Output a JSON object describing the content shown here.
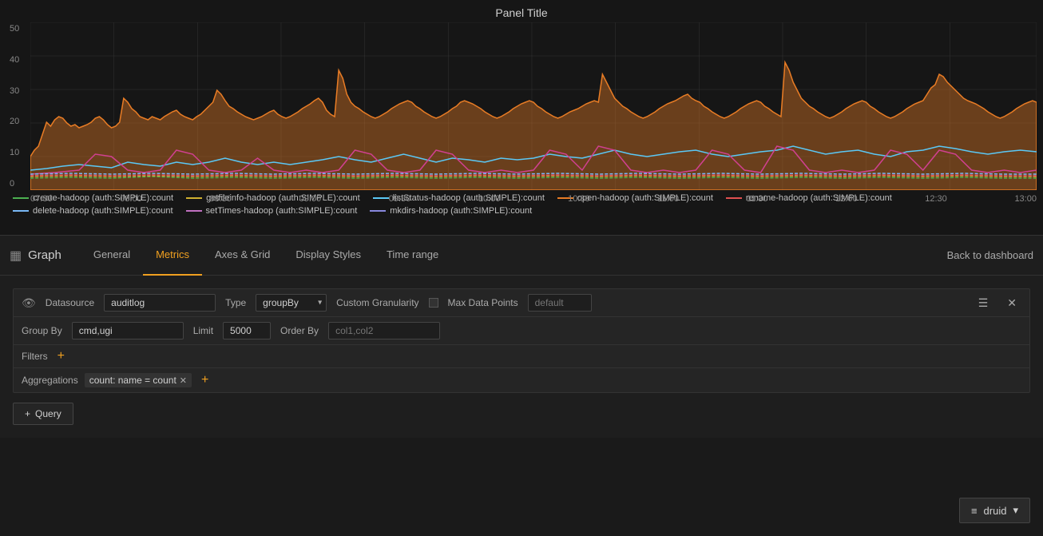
{
  "panel": {
    "title": "Panel Title",
    "yAxisLabels": [
      "0",
      "10",
      "20",
      "30",
      "40",
      "50"
    ],
    "xAxisLabels": [
      "07:30",
      "08:00",
      "08:30",
      "09:00",
      "09:30",
      "10:00",
      "10:30",
      "11:00",
      "11:30",
      "12:00",
      "12:30",
      "13:00"
    ],
    "legend": [
      {
        "label": "create-hadoop (auth:SIMPLE):count",
        "color": "#4caf50",
        "dashed": true
      },
      {
        "label": "getfileinfo-hadoop (auth:SIMPLE):count",
        "color": "#e0c040",
        "dashed": true
      },
      {
        "label": "listStatus-hadoop (auth:SIMPLE):count",
        "color": "#5bc8f5",
        "dashed": true
      },
      {
        "label": "open-hadoop (auth:SIMPLE):count",
        "color": "#e87c25",
        "dashed": false
      },
      {
        "label": "rename-hadoop (auth:SIMPLE):count",
        "color": "#e05050",
        "dashed": true
      },
      {
        "label": "delete-hadoop (auth:SIMPLE):count",
        "color": "#7ab8f5",
        "dashed": true
      },
      {
        "label": "setTimes-hadoop (auth:SIMPLE):count",
        "color": "#c070c0",
        "dashed": true
      },
      {
        "label": "mkdirs-hadoop (auth:SIMPLE):count",
        "color": "#8888dd",
        "dashed": true
      }
    ]
  },
  "tabs": {
    "graph_icon": "▦",
    "graph_label": "Graph",
    "items": [
      {
        "id": "general",
        "label": "General",
        "active": false
      },
      {
        "id": "metrics",
        "label": "Metrics",
        "active": true
      },
      {
        "id": "axes",
        "label": "Axes & Grid",
        "active": false
      },
      {
        "id": "display",
        "label": "Display Styles",
        "active": false
      },
      {
        "id": "timerange",
        "label": "Time range",
        "active": false
      }
    ],
    "back_button": "Back to dashboard"
  },
  "query": {
    "datasource_label": "Datasource",
    "datasource_value": "auditlog",
    "type_label": "Type",
    "type_value": "groupBy",
    "custom_granularity_label": "Custom Granularity",
    "max_data_points_label": "Max Data Points",
    "max_data_points_placeholder": "default",
    "group_by_label": "Group By",
    "group_by_value": "cmd,ugi",
    "limit_label": "Limit",
    "limit_value": "5000",
    "order_by_label": "Order By",
    "order_by_placeholder": "col1,col2",
    "filters_label": "Filters",
    "aggregations_label": "Aggregations",
    "aggregation_tag": "count: name = count",
    "add_query_label": "Query"
  },
  "footer": {
    "druid_icon": "≡",
    "druid_label": "druid",
    "chevron": "▾"
  }
}
